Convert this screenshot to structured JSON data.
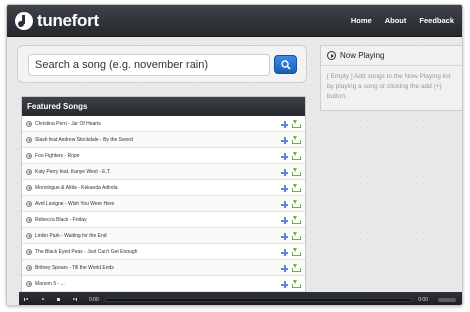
{
  "header": {
    "logo_text": "tunefort",
    "nav": [
      "Home",
      "About",
      "Feedback"
    ]
  },
  "search": {
    "placeholder": "Search a song (e.g. november rain)"
  },
  "featured": {
    "title": "Featured Songs",
    "songs": [
      "Christina Perri - Jar Of Hearts",
      "Slash feat Andrew Stockdale - By the Sword",
      "Foo Fighters - Rope",
      "Katy Perry feat. Kanye West - E.T.",
      "Monologue & Attila - Kekanda Adinda",
      "Avril Lavigne - Wish You Were Here",
      "Rebecca Black - Friday",
      "Linkin Park - Waiting for the End",
      "The Black Eyed Peas - Just Can't Get Enough",
      "Britney Spears - Till the World Ends",
      "Maroon 5 - ..."
    ]
  },
  "now_playing": {
    "title": "Now Playing",
    "empty_text": "[ Empty ] Add songs to the Now Playing list by playing a song or clicking the add (+) button."
  },
  "player": {
    "elapsed": "0:00",
    "duration": "0:00"
  },
  "colors": {
    "header_dark": "#25282d",
    "accent_blue": "#1b5fb8",
    "add_blue": "#4f8fd8",
    "download_green": "#6cae4a"
  }
}
